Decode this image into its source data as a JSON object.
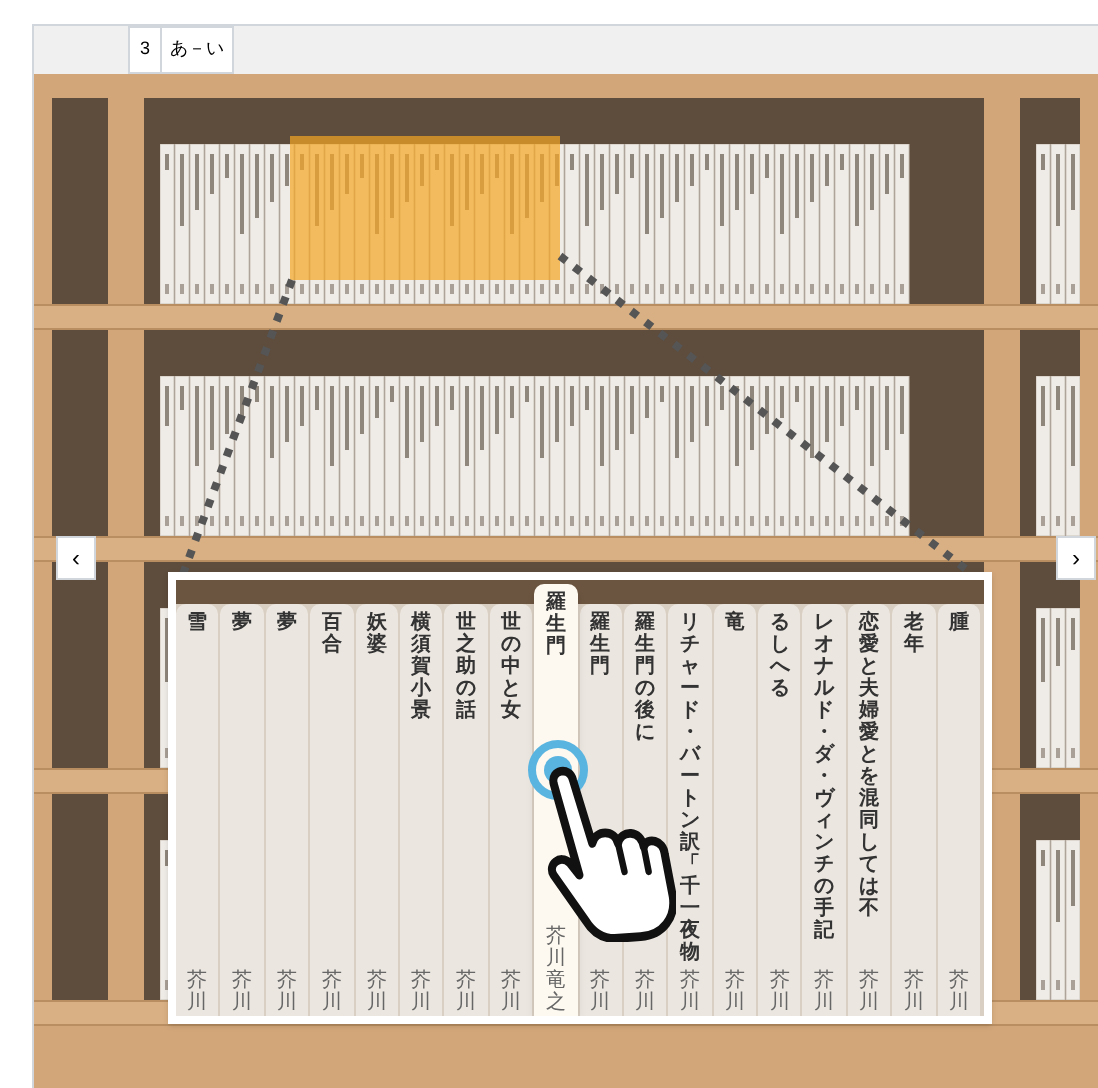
{
  "toolbar": {
    "page_number": "3",
    "range_label": "あ－い"
  },
  "navigation": {
    "previous": "‹",
    "next": "›"
  },
  "magnifier": {
    "books": [
      {
        "title": "雪",
        "author": "芥川",
        "selected": false
      },
      {
        "title": "夢",
        "author": "芥川",
        "selected": false
      },
      {
        "title": "夢",
        "author": "芥川",
        "selected": false
      },
      {
        "title": "百合",
        "author": "芥川",
        "selected": false
      },
      {
        "title": "妖婆",
        "author": "芥川",
        "selected": false
      },
      {
        "title": "横須賀小景",
        "author": "芥川",
        "selected": false
      },
      {
        "title": "世之助の話",
        "author": "芥川",
        "selected": false
      },
      {
        "title": "世の中と女",
        "author": "芥川",
        "selected": false
      },
      {
        "title": "羅生門",
        "author": "芥川竜之",
        "selected": true
      },
      {
        "title": "羅生門",
        "author": "芥川",
        "selected": false
      },
      {
        "title": "羅生門の後に",
        "author": "芥川",
        "selected": false
      },
      {
        "title": "リチャード・バートン訳「千一夜物",
        "author": "芥川",
        "selected": false
      },
      {
        "title": "竜",
        "author": "芥川",
        "selected": false
      },
      {
        "title": "るしへる",
        "author": "芥川",
        "selected": false
      },
      {
        "title": "レオナルド・ダ・ヴィンチの手記",
        "author": "芥川",
        "selected": false
      },
      {
        "title": "恋愛と夫婦愛とを混同しては不",
        "author": "芥川",
        "selected": false
      },
      {
        "title": "老年",
        "author": "芥川",
        "selected": false
      },
      {
        "title": "腫",
        "author": "芥川",
        "selected": false
      }
    ]
  }
}
